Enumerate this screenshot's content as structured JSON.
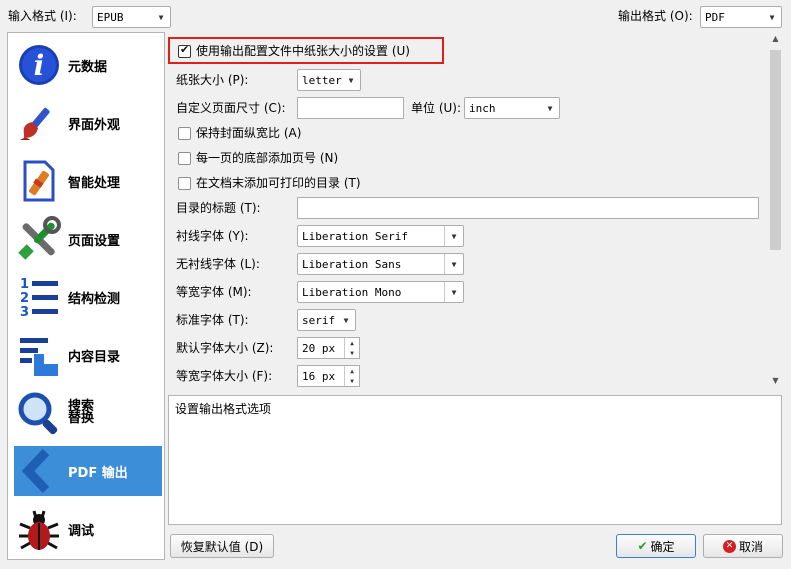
{
  "toolbar": {
    "input_format_label": "输入格式 (I):",
    "input_format_value": "EPUB",
    "output_format_label": "输出格式 (O):",
    "output_format_value": "PDF"
  },
  "sidebar": {
    "items": [
      {
        "label": "元数据",
        "icon": "info-icon"
      },
      {
        "label": "界面外观",
        "icon": "brush-icon"
      },
      {
        "label": "智能处理",
        "icon": "wand-icon"
      },
      {
        "label": "页面设置",
        "icon": "tools-icon"
      },
      {
        "label": "结构检测",
        "icon": "numbered-list-icon"
      },
      {
        "label": "内容目录",
        "icon": "toc-icon"
      },
      {
        "label": "搜索\n替换",
        "icon": "magnifier-icon"
      },
      {
        "label": "PDF 输出",
        "icon": "back-arrow-icon",
        "active": true
      },
      {
        "label": "调试",
        "icon": "bug-icon"
      }
    ]
  },
  "form": {
    "use_profile_size": {
      "label": "使用输出配置文件中纸张大小的设置 (U)",
      "checked": true,
      "highlight_color": "#e0201b"
    },
    "paper_size": {
      "label": "纸张大小 (P):",
      "value": "letter"
    },
    "custom_size": {
      "label": "自定义页面尺寸 (C):",
      "value": "",
      "unit_label": "单位 (U):",
      "unit_value": "inch"
    },
    "keep_aspect": {
      "label": "保持封面纵宽比 (A)",
      "checked": false
    },
    "page_numbers": {
      "label": "每一页的底部添加页号 (N)",
      "checked": false
    },
    "printable_toc": {
      "label": "在文档末添加可打印的目录 (T)",
      "checked": false
    },
    "toc_title": {
      "label": "目录的标题 (T):",
      "value": ""
    },
    "serif_font": {
      "label": "衬线字体 (Y):",
      "value": "Liberation Serif"
    },
    "sans_font": {
      "label": "无衬线字体 (L):",
      "value": "Liberation Sans"
    },
    "mono_font": {
      "label": "等宽字体 (M):",
      "value": "Liberation Mono"
    },
    "standard_font": {
      "label": "标准字体 (T):",
      "value": "serif"
    },
    "default_font_size": {
      "label": "默认字体大小 (Z):",
      "value": "20 px"
    },
    "mono_font_size": {
      "label": "等宽字体大小 (F):",
      "value": "16 px"
    }
  },
  "description": "设置输出格式选项",
  "buttons": {
    "restore_defaults": "恢复默认值 (D)",
    "ok": "确定",
    "cancel": "取消"
  },
  "colors": {
    "active_item": "#3c8ed9",
    "ok_check": "#2e9a2e",
    "cancel_icon": "#d42020"
  }
}
